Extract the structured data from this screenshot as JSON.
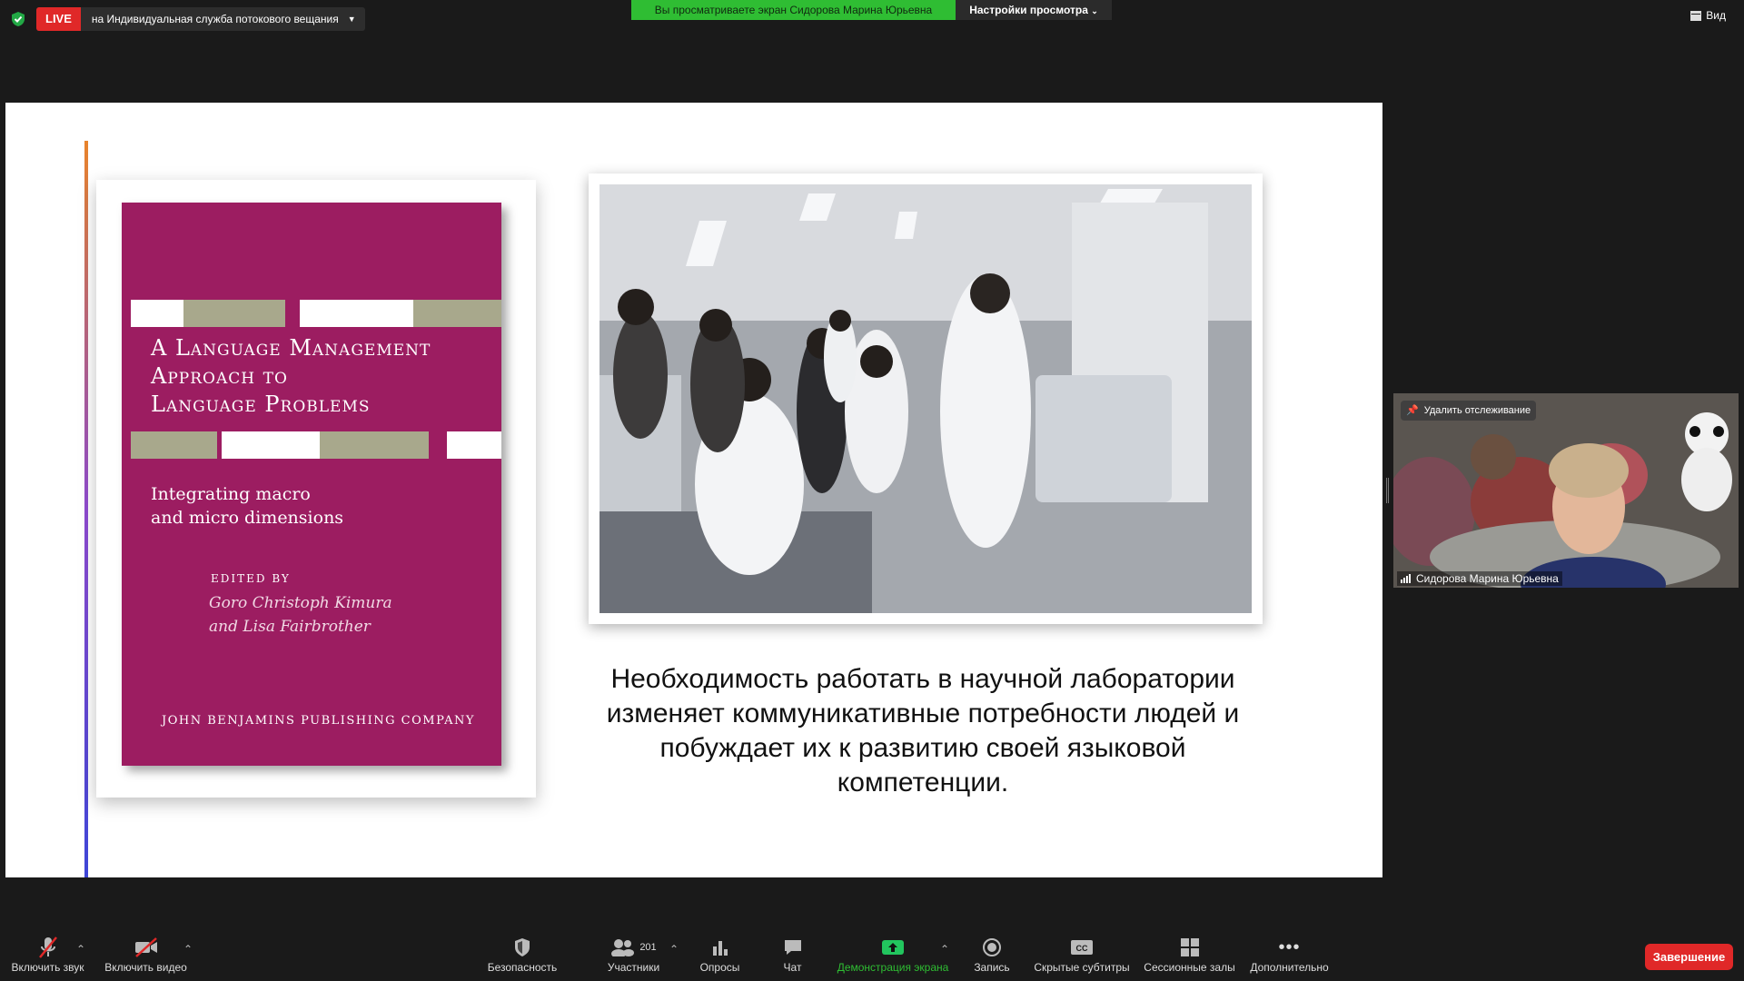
{
  "topbar": {
    "live_badge": "LIVE",
    "live_destination": "на Индивидуальная служба потокового вещания",
    "viewing_banner": "Вы просматриваете экран Сидорова Марина Юрьевна",
    "view_settings": "Настройки просмотра",
    "view_label": "Вид"
  },
  "slide": {
    "book": {
      "title_lines": [
        "A Language Management",
        "Approach to",
        "Language Problems"
      ],
      "subtitle_lines": [
        "Integrating macro",
        "and micro dimensions"
      ],
      "edited_by": "EDITED BY",
      "editors": [
        "Goro Christoph Kimura",
        "and Lisa Fairbrother"
      ],
      "publisher": "JOHN BENJAMINS PUBLISHING COMPANY"
    },
    "text_lines": [
      "Необходимость работать в научной лаборатории",
      "изменяет коммуникативные потребности людей и",
      "побуждает их к развитию своей языковой",
      "компетенции."
    ]
  },
  "video": {
    "unpin_label": "Удалить отслеживание",
    "participant_name": "Сидорова Марина Юрьевна"
  },
  "toolbar": {
    "unmute": "Включить звук",
    "start_video": "Включить видео",
    "security": "Безопасность",
    "participants": "Участники",
    "participants_count": "201",
    "polls": "Опросы",
    "chat": "Чат",
    "share_screen": "Демонстрация экрана",
    "record": "Запись",
    "captions": "Скрытые субтитры",
    "breakout": "Сессионные залы",
    "more": "Дополнительно",
    "end": "Завершение"
  },
  "colors": {
    "live_red": "#e02828",
    "banner_green": "#2fbd33",
    "book_magenta": "#9c1d61",
    "share_green": "#22c55e"
  }
}
